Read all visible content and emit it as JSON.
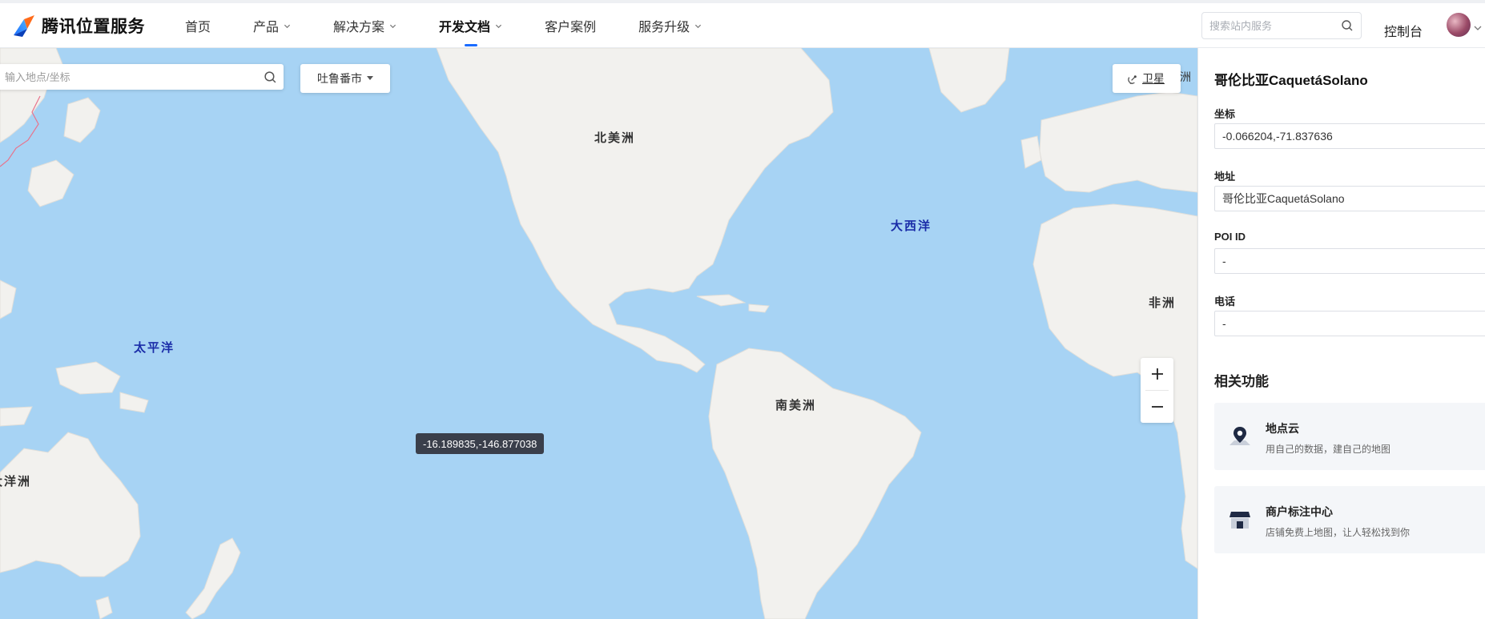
{
  "brand": {
    "name": "腾讯位置服务"
  },
  "nav": {
    "items": [
      {
        "label": "首页",
        "has_dropdown": false,
        "active": false
      },
      {
        "label": "产品",
        "has_dropdown": true,
        "active": false
      },
      {
        "label": "解决方案",
        "has_dropdown": true,
        "active": false
      },
      {
        "label": "开发文档",
        "has_dropdown": true,
        "active": true
      },
      {
        "label": "客户案例",
        "has_dropdown": false,
        "active": false
      },
      {
        "label": "服务升级",
        "has_dropdown": true,
        "active": false
      }
    ]
  },
  "header": {
    "search_placeholder": "搜索站内服务",
    "console_label": "控制台"
  },
  "map": {
    "search_placeholder": "输入地点/坐标",
    "city_select": "吐鲁番市",
    "satellite_label": "卫星",
    "edge_label": "洲",
    "labels": {
      "north_america": "北美洲",
      "south_america": "南美洲",
      "africa": "非洲",
      "oceania": "大洋洲",
      "pacific": "太平洋",
      "atlantic": "大西洋"
    },
    "zoom_in": "+",
    "zoom_out": "−",
    "hover_coord": "-16.189835,-146.877038"
  },
  "panel": {
    "title": "哥伦比亚CaquetáSolano",
    "coord_label": "坐标",
    "coord_value": "-0.066204,-71.837636",
    "address_label": "地址",
    "address_value": "哥伦比亚CaquetáSolano",
    "poi_label": "POI ID",
    "poi_value": "-",
    "phone_label": "电话",
    "phone_value": "-",
    "related_title": "相关功能",
    "cards": [
      {
        "title": "地点云",
        "desc": "用自己的数据，建自己的地图",
        "icon": "location-pin-icon"
      },
      {
        "title": "商户标注中心",
        "desc": "店铺免费上地图，让人轻松找到你",
        "icon": "storefront-icon"
      }
    ]
  },
  "colors": {
    "accent": "#1a6cff",
    "ocean": "#a7d3f4",
    "land": "#f2f1ee",
    "card_bg": "#f4f6f9",
    "ocean_label": "#1a2ca8"
  }
}
